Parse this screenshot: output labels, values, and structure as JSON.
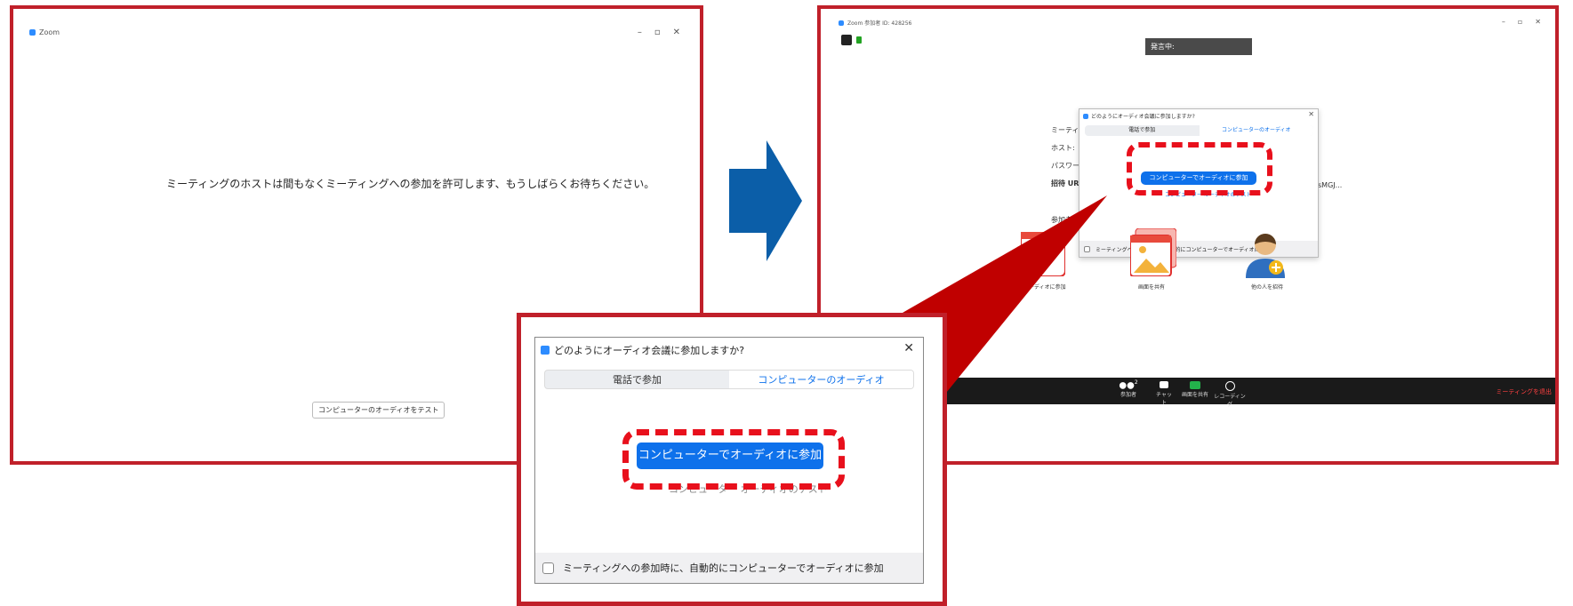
{
  "left_window": {
    "title": "Zoom",
    "controls": [
      "–",
      "▫",
      "✕"
    ],
    "wait_message": "ミーティングのホストは間もなくミーティングへの参加を許可します、もうしばらくお待ちください。",
    "test_audio_button": "コンピューターのオーディオをテスト"
  },
  "right_window": {
    "title": "Zoom 参加者 ID: 428256",
    "controls": [
      "–",
      "▫",
      "✕"
    ],
    "speaker_bar": "発言中:",
    "info_labels": [
      "ミーティング",
      "ホスト:",
      "パスワード",
      "招待 URL",
      "参加者"
    ],
    "info_url_tail": "sMGJ...",
    "dialog": {
      "title": "どのようにオーディオ会議に参加しますか?",
      "tab_phone": "電話で参加",
      "tab_computer": "コンピューターのオーディオ",
      "join_button": "コンピューターでオーディオに参加",
      "test_link": "コンピューター オーディオのテスト",
      "auto_checkbox": "ミーティングへの参加時に、自動的にコンピューターでオーディオに参加"
    },
    "actions": [
      {
        "label": "オーディオに参加",
        "icon": "headphones-icon"
      },
      {
        "label": "画面を共有",
        "icon": "share-screen-icon"
      },
      {
        "label": "他の人を招待",
        "icon": "invite-icon"
      }
    ],
    "toolbar": {
      "participants": "参加者",
      "participants_count": "2",
      "chat": "チャット",
      "share": "画面を共有",
      "record": "レコーディング",
      "leave": "ミーティングを退出"
    }
  },
  "zoom_dialog": {
    "title": "どのようにオーディオ会議に参加しますか?",
    "close": "✕",
    "tab_phone": "電話で参加",
    "tab_computer": "コンピューターのオーディオ",
    "join_button": "コンピューターでオーディオに参加",
    "test_link": "コンピューター オーディオのテスト",
    "auto_checkbox": "ミーティングへの参加時に、自動的にコンピューターでオーディオに参加"
  },
  "colors": {
    "frame_red": "#c0202a",
    "dash_red": "#e8101c",
    "arrow_blue": "#0b5ea8",
    "zoom_blue": "#0e71eb"
  }
}
